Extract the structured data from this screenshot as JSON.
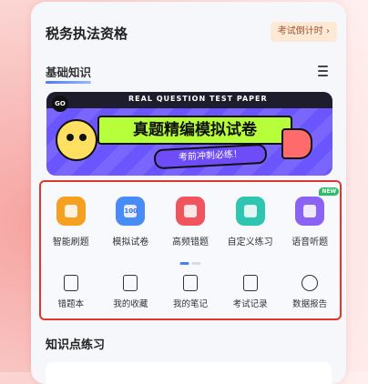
{
  "header": {
    "title": "税务执法资格",
    "countdown_label": "考试倒计时",
    "countdown_arrow": "›"
  },
  "section_basic": {
    "title": "基础知识"
  },
  "banner": {
    "go_label": "GO",
    "subtitle": "REAL QUESTION TEST PAPER",
    "title": "真题精编模拟试卷",
    "slogan": "考前冲刺必练！"
  },
  "main_tools": [
    {
      "label": "智能刷题",
      "icon": "smart-practice-icon",
      "color": "#f5a020"
    },
    {
      "label": "模拟试卷",
      "icon": "mock-exam-icon",
      "color": "#4a8cf7",
      "inner": "100"
    },
    {
      "label": "高频错题",
      "icon": "frequent-error-icon",
      "color": "#f0555d"
    },
    {
      "label": "自定义练习",
      "icon": "custom-practice-icon",
      "color": "#2ec6b0"
    },
    {
      "label": "语音听题",
      "icon": "audio-question-icon",
      "color": "#8a63f5",
      "badge": "NEW"
    }
  ],
  "secondary_tools": [
    {
      "label": "错题本",
      "icon": "error-book-icon"
    },
    {
      "label": "我的收藏",
      "icon": "favorites-icon"
    },
    {
      "label": "我的笔记",
      "icon": "notes-icon"
    },
    {
      "label": "考试记录",
      "icon": "exam-record-icon"
    },
    {
      "label": "数据报告",
      "icon": "data-report-icon"
    }
  ],
  "section_knowledge": {
    "title": "知识点练习"
  },
  "colors": {
    "accent": "#4a7cf7",
    "highlight_border": "#e0372c"
  }
}
